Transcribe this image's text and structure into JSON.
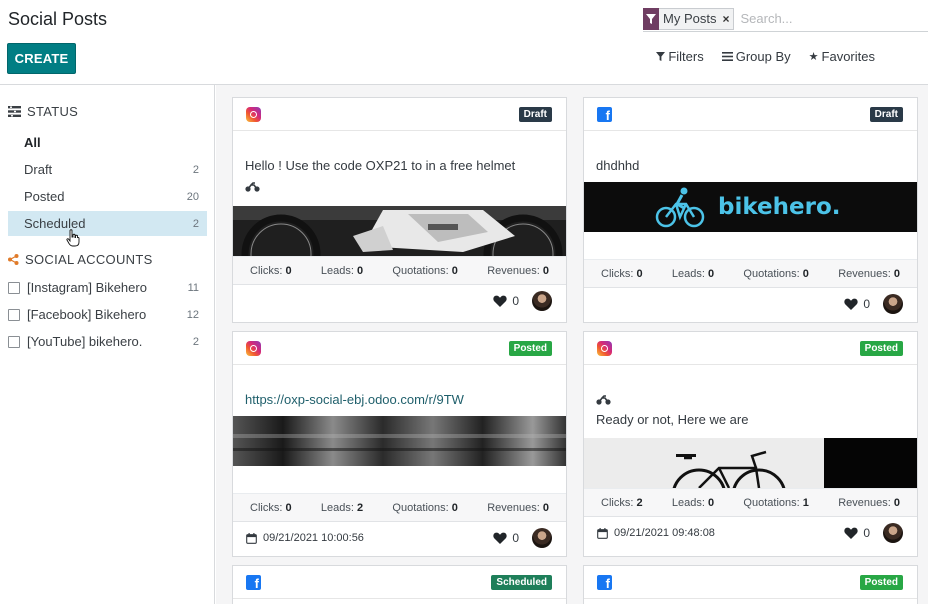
{
  "header": {
    "title": "Social Posts",
    "create_label": "CREATE",
    "facet_label": "My Posts",
    "facet_remove": "×",
    "search_placeholder": "Search...",
    "filters_label": "Filters",
    "groupby_label": "Group By",
    "favorites_label": "Favorites"
  },
  "sidebar": {
    "status_title": "STATUS",
    "status_items": [
      {
        "label": "All",
        "count": ""
      },
      {
        "label": "Draft",
        "count": "2"
      },
      {
        "label": "Posted",
        "count": "20"
      },
      {
        "label": "Scheduled",
        "count": "2"
      }
    ],
    "accounts_title": "SOCIAL ACCOUNTS",
    "accounts": [
      {
        "label": "[Instagram] Bikehero",
        "count": "11"
      },
      {
        "label": "[Facebook] Bikehero",
        "count": "12"
      },
      {
        "label": "[YouTube] bikehero.",
        "count": "2"
      }
    ]
  },
  "cards": [
    {
      "network_icon": "instagram-icon",
      "status": "Draft",
      "message": "Hello ! Use the code OXP21 to in a free helmet",
      "stats": {
        "clicks_label": "Clicks:",
        "clicks": "0",
        "leads_label": "Leads:",
        "leads": "0",
        "quotations_label": "Quotations:",
        "quotations": "0",
        "revenues_label": "Revenues:",
        "revenues": "0"
      },
      "date": "",
      "likes": "0"
    },
    {
      "network_icon": "facebook-icon",
      "status": "Draft",
      "message": "dhdhhd",
      "image_text": "bikehero.",
      "stats": {
        "clicks_label": "Clicks:",
        "clicks": "0",
        "leads_label": "Leads:",
        "leads": "0",
        "quotations_label": "Quotations:",
        "quotations": "0",
        "revenues_label": "Revenues:",
        "revenues": "0"
      },
      "date": "",
      "likes": "0"
    },
    {
      "network_icon": "instagram-icon",
      "status": "Posted",
      "message": "https://oxp-social-ebj.odoo.com/r/9TW",
      "stats": {
        "clicks_label": "Clicks:",
        "clicks": "0",
        "leads_label": "Leads:",
        "leads": "2",
        "quotations_label": "Quotations:",
        "quotations": "0",
        "revenues_label": "Revenues:",
        "revenues": "0"
      },
      "date": "09/21/2021 10:00:56",
      "likes": "0"
    },
    {
      "network_icon": "instagram-icon",
      "status": "Posted",
      "message": "Ready or not, Here we are",
      "stats": {
        "clicks_label": "Clicks:",
        "clicks": "2",
        "leads_label": "Leads:",
        "leads": "0",
        "quotations_label": "Quotations:",
        "quotations": "1",
        "revenues_label": "Revenues:",
        "revenues": "0"
      },
      "date": "09/21/2021 09:48:08",
      "likes": "0"
    },
    {
      "network_icon": "facebook-icon",
      "status": "Scheduled"
    },
    {
      "network_icon": "facebook-icon",
      "status": "Posted"
    }
  ],
  "colors": {
    "primary": "#017e84",
    "draft_badge": "#2a3a48",
    "posted_badge": "#28a745",
    "scheduled_badge": "#1e7f5a",
    "active_filter": "#d2e8f2"
  }
}
